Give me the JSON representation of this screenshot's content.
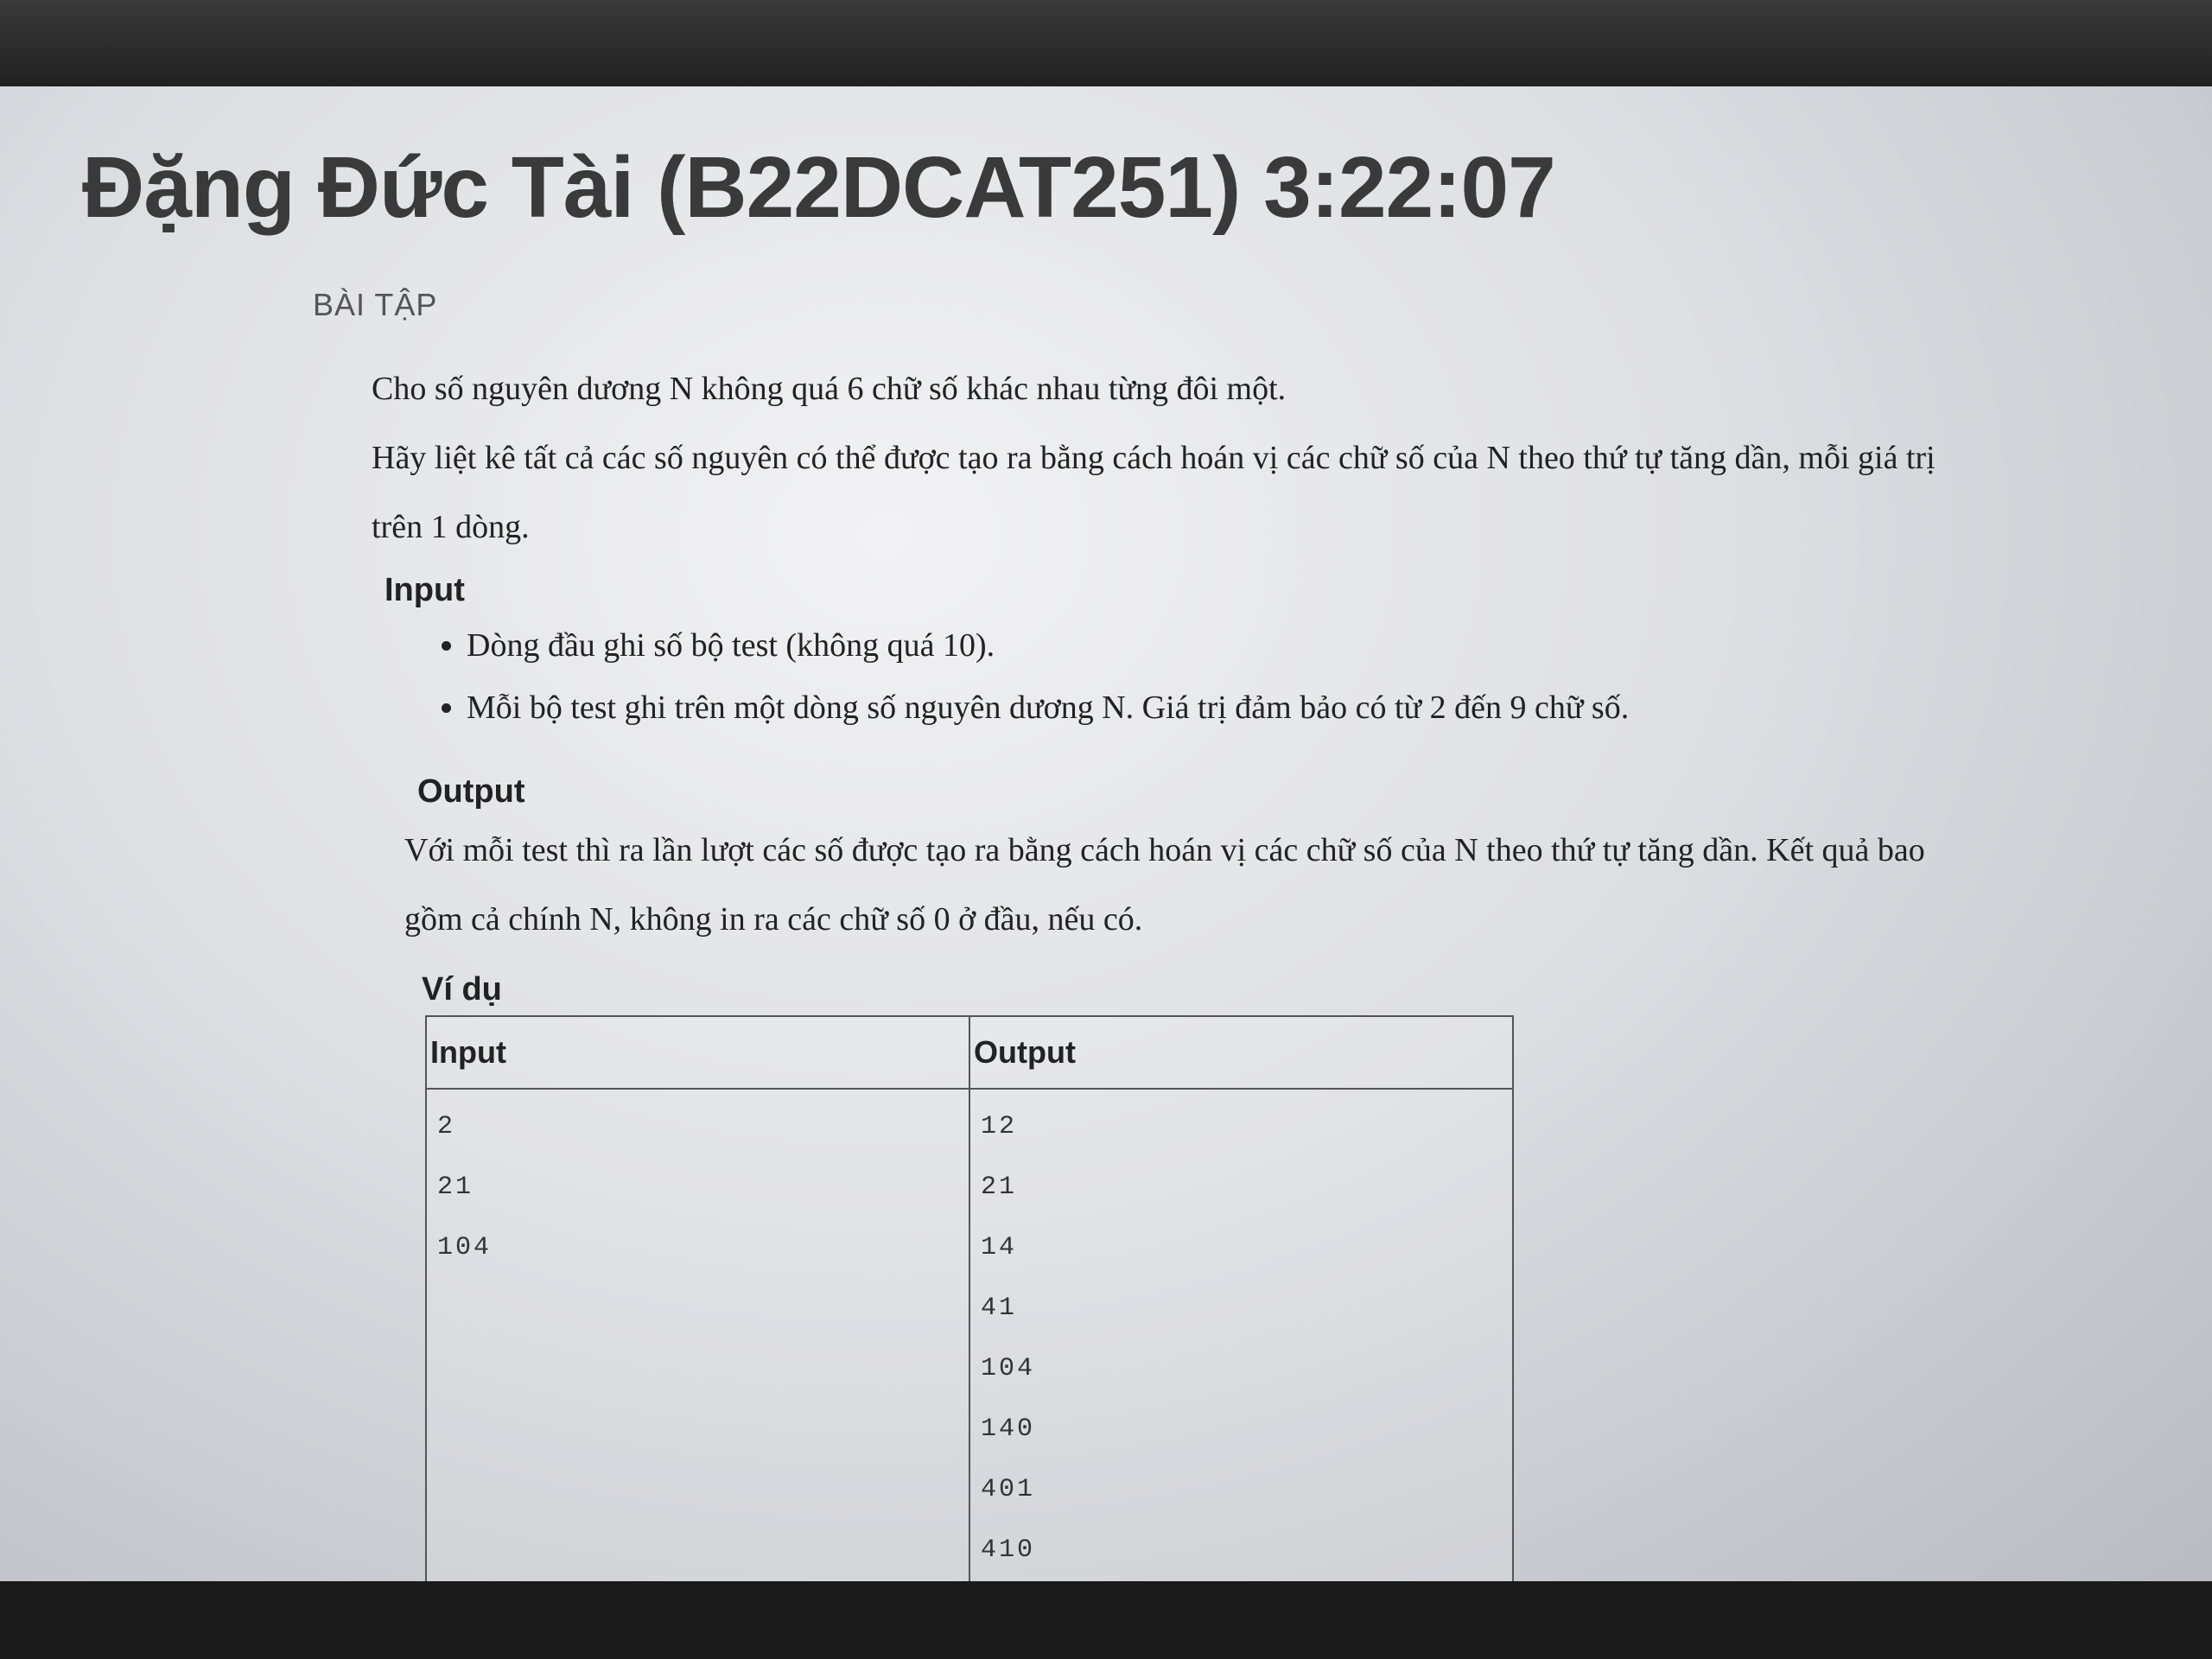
{
  "header": {
    "student": "Đặng Đức Tài (B22DCAT251)",
    "timer": "3:22:07"
  },
  "section_label": "BÀI TẬP",
  "problem": {
    "intro": "Cho số nguyên dương N không quá 6 chữ số khác nhau từng đôi một.",
    "task": "Hãy liệt kê tất cả các số nguyên có thể được tạo ra bằng cách hoán vị các chữ số của N theo thứ tự tăng dần, mỗi giá trị trên 1 dòng.",
    "input_title": "Input",
    "input_items": [
      "Dòng đầu ghi số bộ test (không quá 10).",
      "Mỗi bộ test ghi trên một dòng số nguyên dương N. Giá trị đảm bảo có từ 2 đến 9 chữ số."
    ],
    "output_title": "Output",
    "output_text": "Với mỗi test thì ra lần lượt các số được tạo ra bằng cách hoán vị các chữ số của N theo thứ tự tăng dần. Kết quả bao gồm cả chính N, không in ra các chữ số 0 ở đầu, nếu có."
  },
  "example": {
    "title": "Ví dụ",
    "input_header": "Input",
    "output_header": "Output",
    "input_lines": [
      "2",
      "21",
      "104"
    ],
    "output_lines": [
      "12",
      "21",
      "14",
      "41",
      "104",
      "140",
      "401",
      "410"
    ]
  }
}
